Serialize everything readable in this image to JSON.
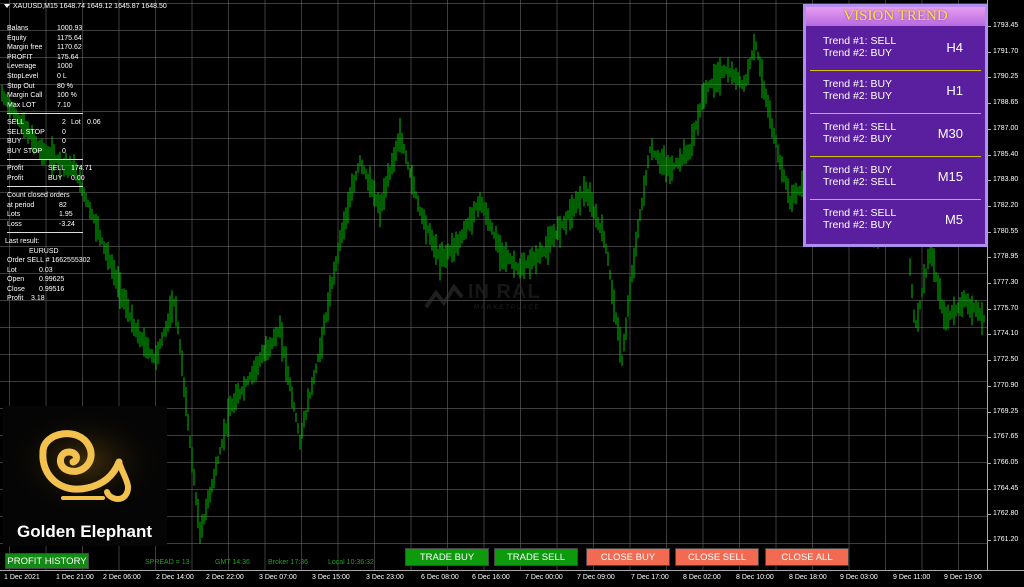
{
  "chart": {
    "symbol_header": "XAUUSD,M15  1648.74  1649.12  1645.87  1648.50",
    "candle_color": "#00c000",
    "grid_color": "#6e6e6e"
  },
  "account": [
    {
      "key": "Balans",
      "value": "1000.93"
    },
    {
      "key": "Equity",
      "value": "1175.64"
    },
    {
      "key": "Margin free",
      "value": "1170.62"
    },
    {
      "key": "PROFIT",
      "value": "175.64"
    },
    {
      "key": "Leverage",
      "value": "1000"
    },
    {
      "key": "StopLevel",
      "value": "0 L"
    },
    {
      "key": "Stop Out",
      "value": "80 %"
    },
    {
      "key": "Margin Call",
      "value": "100 %"
    },
    {
      "key": "Max LOT",
      "value": "7.10"
    }
  ],
  "orders": {
    "sell": "SELL",
    "sell_count": "2",
    "lot_label": "Lot",
    "sell_lot": "0.06",
    "sell_stop": "SELL STOP",
    "sell_stop_val": "0",
    "buy": "BUY",
    "buy_val": "0",
    "buy_stop": "BUY STOP",
    "buy_stop_val": "0"
  },
  "profit": {
    "label": "Profit",
    "sell": "SELL",
    "sell_val": "174.71",
    "buy": "BUY",
    "buy_val": "0.00"
  },
  "closed": {
    "title": "Count closed orders",
    "period": "at period",
    "period_val": "82",
    "lots": "Lots",
    "lots_val": "1.95",
    "loss": "Loss",
    "loss_val": "-3.24"
  },
  "last_result": {
    "title": "Last result:",
    "symbol": "EURUSD",
    "order": "Order  SELL  # 1662555302",
    "lot": "Lot",
    "lot_val": "0.03",
    "open": "Open",
    "open_val": "0.99625",
    "close": "Close",
    "close_val": "0.99516",
    "profit": "Profit",
    "profit_val": "3.18"
  },
  "watermark": {
    "text": "IN   RAL",
    "sub": "MARKETPLACE"
  },
  "logo": {
    "name": "Golden Elephant",
    "icon": "golden-elephant-logo-icon",
    "gold": "#f2c14e"
  },
  "vision_trend": {
    "title": "VISION TREND",
    "rows": [
      {
        "t1": "Trend #1: SELL",
        "t2": "Trend #2: BUY",
        "tf": "H4"
      },
      {
        "t1": "Trend #1: BUY",
        "t2": "Trend #2: BUY",
        "tf": "H1"
      },
      {
        "t1": "Trend #1: SELL",
        "t2": "Trend #2: BUY",
        "tf": "M30"
      },
      {
        "t1": "Trend #1: BUY",
        "t2": "Trend #2: SELL",
        "tf": "M15"
      },
      {
        "t1": "Trend #1: SELL",
        "t2": "Trend #2: BUY",
        "tf": "M5"
      }
    ]
  },
  "price_axis": [
    "1793.45",
    "1791.70",
    "1790.25",
    "1788.65",
    "1787.00",
    "1785.40",
    "1783.80",
    "1782.20",
    "1780.55",
    "1778.95",
    "1777.30",
    "1775.70",
    "1774.10",
    "1772.50",
    "1770.90",
    "1769.25",
    "1767.65",
    "1766.05",
    "1764.45",
    "1762.80",
    "1761.20"
  ],
  "time_axis": [
    "1 Dec 2021",
    "1 Dec 21:00",
    "2 Dec 06:00",
    "2 Dec 14:00",
    "2 Dec 22:00",
    "3 Dec 07:00",
    "3 Dec 15:00",
    "3 Dec 23:00",
    "6 Dec 08:00",
    "6 Dec 16:00",
    "7 Dec 00:00",
    "7 Dec 09:00",
    "7 Dec 17:00",
    "8 Dec 02:00",
    "8 Dec 10:00",
    "8 Dec 18:00",
    "9 Dec 03:00",
    "9 Dec 11:00",
    "9 Dec 19:00"
  ],
  "bottom": {
    "profit_history": "PROFIT HISTORY",
    "spread": "SPREAD = 13",
    "gmt": "GMT 14:36",
    "broker": "Broker 17:36",
    "local": "Local 10:36:32",
    "trade_buy": "TRADE BUY",
    "trade_sell": "TRADE SELL",
    "close_buy": "CLOSE BUY",
    "close_sell": "CLOSE SELL",
    "close_all": "CLOSE ALL"
  }
}
